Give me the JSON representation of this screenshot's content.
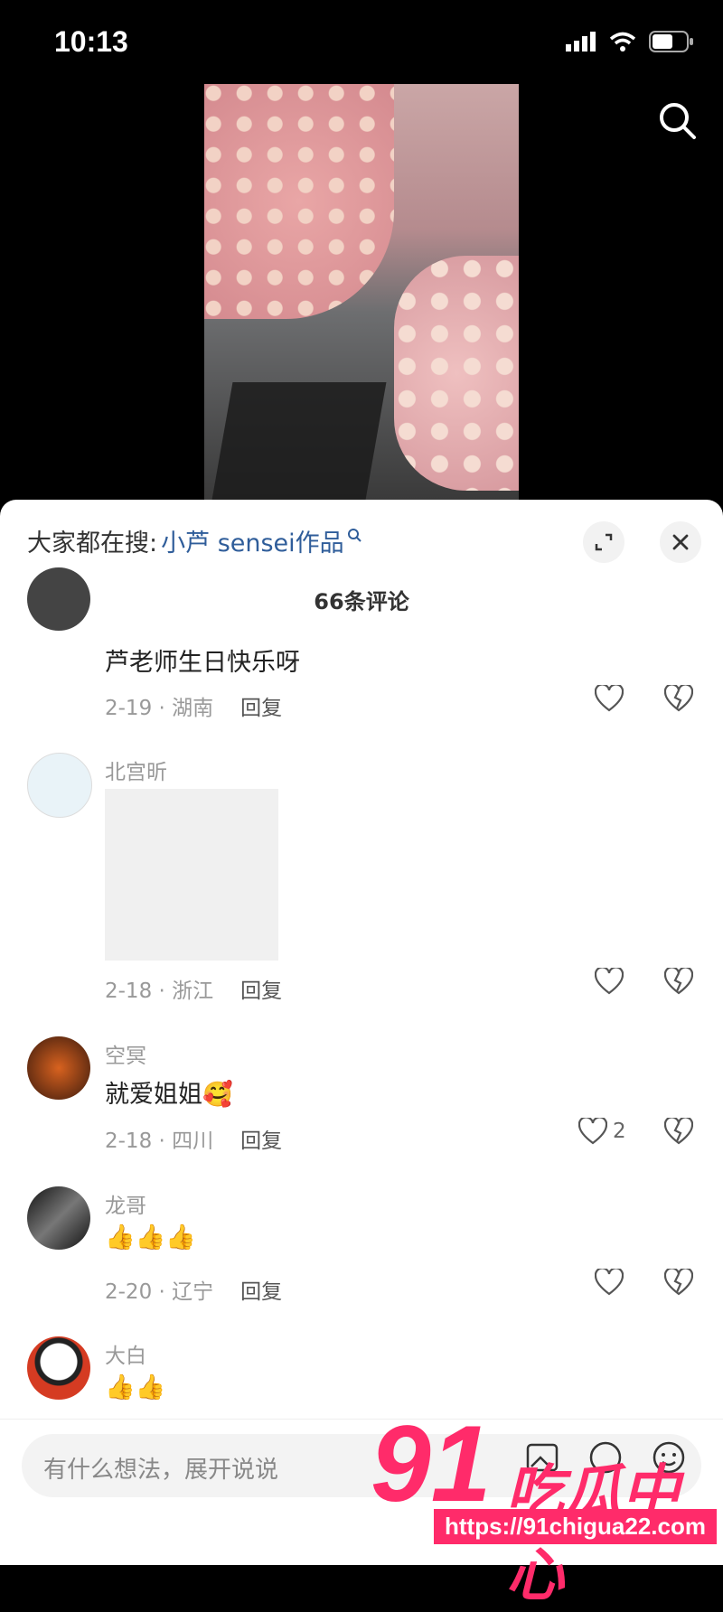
{
  "status": {
    "time": "10:13"
  },
  "sheet": {
    "hot_prefix": "大家都在搜:",
    "hot_link": "小芦 sensei作品",
    "comment_count": "66条评论"
  },
  "comments": [
    {
      "text": "芦老师生日快乐呀",
      "meta": "2-19 · 湖南",
      "reply": "回复",
      "likes": ""
    },
    {
      "user": "北宫昕",
      "meta": "2-18 · 浙江",
      "reply": "回复",
      "likes": ""
    },
    {
      "user": "空冥",
      "text": "就爱姐姐🥰",
      "meta": "2-18 · 四川",
      "reply": "回复",
      "likes": "2"
    },
    {
      "user": "龙哥",
      "text": "👍👍👍",
      "meta": "2-20 · 辽宁",
      "reply": "回复",
      "likes": ""
    },
    {
      "user": "大白",
      "text": "👍👍"
    }
  ],
  "input": {
    "placeholder": "有什么想法，展开说说"
  },
  "watermark": {
    "big": "91",
    "cn": "吃瓜中心",
    "url": "https://91chigua22.com"
  },
  "colors": {
    "link": "#2f5d9a",
    "watermark": "#ff2b6a"
  }
}
